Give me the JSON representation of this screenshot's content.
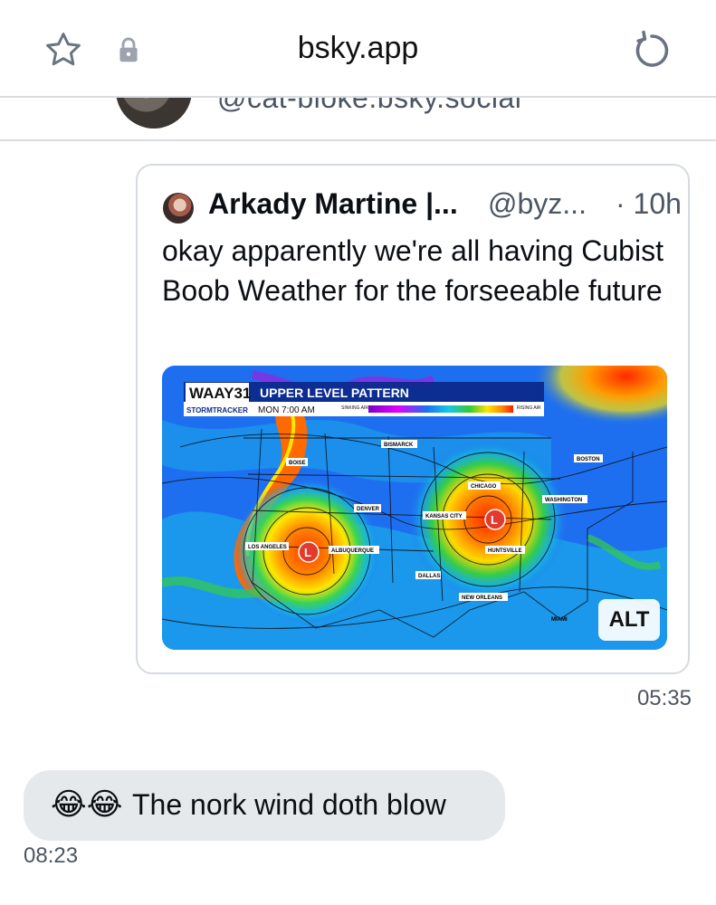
{
  "browser": {
    "domain": "bsky.app",
    "icons": [
      "star-icon",
      "lock-icon",
      "reload-icon"
    ]
  },
  "conversation_header": {
    "handle": "@cat-bloke.bsky.social"
  },
  "quoted_post": {
    "author_name": "Arkady Martine |...",
    "author_handle": "@byz...",
    "time": "· 10h",
    "text": "okay apparently we're all having Cubist Boob Weather for the forseeable future",
    "image": {
      "station_logo": "WAAY31",
      "station_sub": "STORMTRACKER",
      "title": "UPPER LEVEL PATTERN",
      "time_label": "MON 7:00 AM",
      "scale_left": "SINKING AIR",
      "scale_right": "RISING AIR",
      "alt_label": "ALT",
      "cities": [
        "BISMARCK",
        "BOISE",
        "BOSTON",
        "CHICAGO",
        "WASHINGTON",
        "DENVER",
        "KANSAS CITY",
        "LOS ANGELES",
        "ALBUQUERQUE",
        "HUNTSVILLE",
        "DALLAS",
        "NEW ORLEANS",
        "MIAMI"
      ],
      "low_marker": "L"
    }
  },
  "messages": [
    {
      "time": "05:35"
    },
    {
      "emoji": "😂😂",
      "text": "The nork wind doth blow",
      "time": "08:23"
    }
  ],
  "colors": {
    "bubble": "#e6e9ec",
    "muted": "#4b5563",
    "border": "#d6dbe1"
  }
}
